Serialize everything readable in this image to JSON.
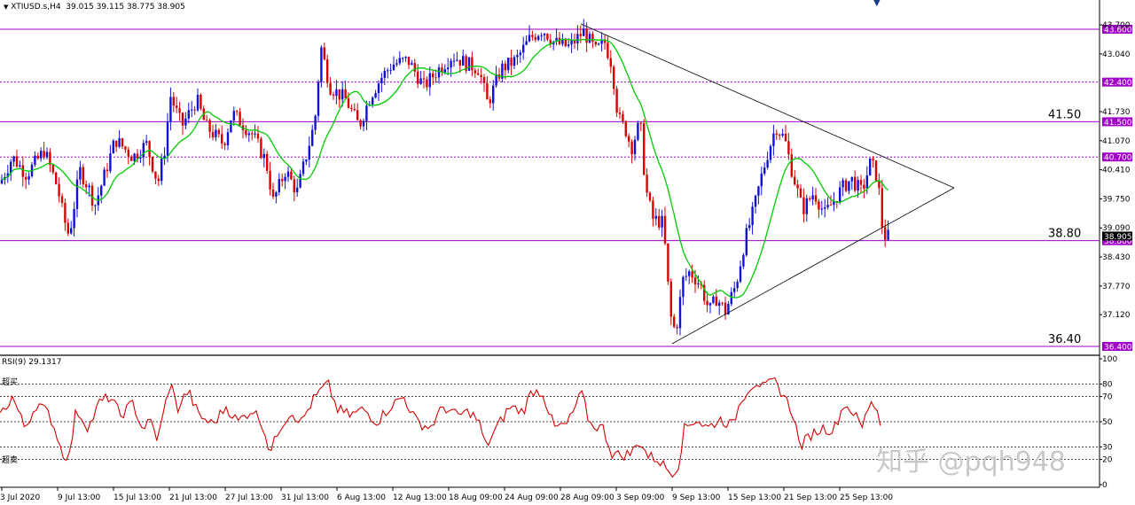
{
  "header": {
    "symbol": "XTIUSD.s,H4",
    "ohlc": "39.015 39.115 38.775 38.905",
    "rsi_label": "RSI(9) 29.1317",
    "overbought_label": "超买",
    "oversold_label": "超卖"
  },
  "watermark": "知乎 @pqh948",
  "chart_data": [
    {
      "type": "candlestick",
      "price_ticks": [
        "43.700",
        "43.040",
        "41.730",
        "41.070",
        "40.410",
        "39.750",
        "39.090",
        "38.430",
        "37.770",
        "37.120"
      ],
      "ylim": [
        36.4,
        43.7
      ],
      "current_price": "38.905",
      "levels": [
        {
          "value": 43.6,
          "label": "43.600"
        },
        {
          "value": 42.4,
          "label": "42.400",
          "style": "dotted"
        },
        {
          "value": 41.5,
          "label": "41.500",
          "text": "41.50"
        },
        {
          "value": 40.7,
          "label": "40.700",
          "style": "dotted"
        },
        {
          "value": 38.8,
          "label": "38.800",
          "text": "38.80"
        },
        {
          "value": 36.4,
          "label": "36.400",
          "text": "36.40"
        }
      ],
      "x_ticks": [
        "3 Jul 2020",
        "9 Jul 13:00",
        "15 Jul 13:00",
        "21 Jul 13:00",
        "27 Jul 13:00",
        "31 Jul 13:00",
        "6 Aug 13:00",
        "12 Aug 13:00",
        "18 Aug 09:00",
        "24 Aug 09:00",
        "28 Aug 09:00",
        "3 Sep 09:00",
        "9 Sep 13:00",
        "15 Sep 13:00",
        "21 Sep 13:00",
        "25 Sep 13:00"
      ],
      "close_path": [
        [
          0,
          40.1
        ],
        [
          14,
          40.7
        ],
        [
          30,
          40.3
        ],
        [
          50,
          40.85
        ],
        [
          65,
          40.0
        ],
        [
          72,
          39.3
        ],
        [
          78,
          38.9
        ],
        [
          90,
          40.4
        ],
        [
          100,
          40.0
        ],
        [
          107,
          39.6
        ],
        [
          118,
          40.3
        ],
        [
          130,
          41.1
        ],
        [
          150,
          40.7
        ],
        [
          165,
          41.0
        ],
        [
          178,
          40.1
        ],
        [
          186,
          40.9
        ],
        [
          192,
          42.1
        ],
        [
          205,
          41.4
        ],
        [
          222,
          42.0
        ],
        [
          232,
          41.4
        ],
        [
          252,
          41.0
        ],
        [
          262,
          41.7
        ],
        [
          285,
          41.2
        ],
        [
          300,
          40.6
        ],
        [
          308,
          39.7
        ],
        [
          322,
          40.4
        ],
        [
          335,
          39.9
        ],
        [
          345,
          40.7
        ],
        [
          355,
          41.5
        ],
        [
          362,
          43.2
        ],
        [
          372,
          42.3
        ],
        [
          390,
          42.0
        ],
        [
          405,
          41.4
        ],
        [
          418,
          42.1
        ],
        [
          430,
          42.5
        ],
        [
          442,
          42.8
        ],
        [
          460,
          42.9
        ],
        [
          478,
          42.3
        ],
        [
          495,
          42.7
        ],
        [
          510,
          43.0
        ],
        [
          528,
          42.8
        ],
        [
          540,
          42.7
        ],
        [
          550,
          41.9
        ],
        [
          565,
          42.7
        ],
        [
          582,
          42.9
        ],
        [
          598,
          43.4
        ],
        [
          612,
          43.6
        ],
        [
          625,
          43.3
        ],
        [
          642,
          43.2
        ],
        [
          658,
          43.55
        ],
        [
          672,
          43.1
        ],
        [
          682,
          43.3
        ],
        [
          690,
          42.8
        ],
        [
          697,
          41.6
        ],
        [
          706,
          41.3
        ],
        [
          712,
          40.9
        ],
        [
          722,
          41.5
        ],
        [
          728,
          40.0
        ],
        [
          736,
          39.3
        ],
        [
          748,
          39.2
        ],
        [
          756,
          37.1
        ],
        [
          762,
          36.7
        ],
        [
          770,
          37.9
        ],
        [
          778,
          38.1
        ],
        [
          790,
          37.8
        ],
        [
          800,
          37.2
        ],
        [
          808,
          37.5
        ],
        [
          818,
          37.2
        ],
        [
          830,
          37.8
        ],
        [
          840,
          38.8
        ],
        [
          850,
          39.5
        ],
        [
          858,
          40.2
        ],
        [
          866,
          40.8
        ],
        [
          875,
          41.4
        ],
        [
          885,
          41.1
        ],
        [
          893,
          40.4
        ],
        [
          905,
          39.5
        ],
        [
          918,
          39.9
        ],
        [
          930,
          39.4
        ],
        [
          940,
          39.7
        ],
        [
          950,
          40.0
        ],
        [
          960,
          40.2
        ],
        [
          972,
          39.9
        ],
        [
          982,
          40.6
        ],
        [
          990,
          40.2
        ],
        [
          996,
          38.9
        ],
        [
          1005,
          38.9
        ]
      ],
      "rsi": {
        "ticks": [
          "100",
          "80",
          "70",
          "50",
          "30",
          "20",
          "0"
        ],
        "ylim": [
          0,
          100
        ],
        "levels": [
          80,
          70,
          50,
          30,
          20
        ],
        "path": [
          [
            0,
            55
          ],
          [
            14,
            70
          ],
          [
            28,
            45
          ],
          [
            42,
            65
          ],
          [
            56,
            55
          ],
          [
            64,
            40
          ],
          [
            70,
            25
          ],
          [
            78,
            22
          ],
          [
            86,
            60
          ],
          [
            100,
            45
          ],
          [
            112,
            65
          ],
          [
            124,
            70
          ],
          [
            136,
            55
          ],
          [
            150,
            65
          ],
          [
            160,
            45
          ],
          [
            170,
            50
          ],
          [
            178,
            35
          ],
          [
            186,
            62
          ],
          [
            192,
            82
          ],
          [
            200,
            60
          ],
          [
            212,
            75
          ],
          [
            224,
            55
          ],
          [
            240,
            48
          ],
          [
            255,
            62
          ],
          [
            268,
            50
          ],
          [
            285,
            60
          ],
          [
            296,
            48
          ],
          [
            305,
            25
          ],
          [
            315,
            45
          ],
          [
            328,
            58
          ],
          [
            340,
            50
          ],
          [
            352,
            66
          ],
          [
            362,
            75
          ],
          [
            370,
            80
          ],
          [
            380,
            60
          ],
          [
            395,
            55
          ],
          [
            410,
            60
          ],
          [
            425,
            50
          ],
          [
            440,
            62
          ],
          [
            455,
            70
          ],
          [
            470,
            50
          ],
          [
            485,
            45
          ],
          [
            500,
            62
          ],
          [
            515,
            55
          ],
          [
            530,
            58
          ],
          [
            540,
            50
          ],
          [
            548,
            30
          ],
          [
            560,
            45
          ],
          [
            575,
            62
          ],
          [
            590,
            58
          ],
          [
            600,
            75
          ],
          [
            612,
            73
          ],
          [
            625,
            45
          ],
          [
            640,
            48
          ],
          [
            656,
            73
          ],
          [
            665,
            48
          ],
          [
            680,
            45
          ],
          [
            690,
            25
          ],
          [
            700,
            23
          ],
          [
            712,
            25
          ],
          [
            722,
            35
          ],
          [
            730,
            23
          ],
          [
            742,
            20
          ],
          [
            756,
            10
          ],
          [
            764,
            12
          ],
          [
            772,
            45
          ],
          [
            785,
            52
          ],
          [
            798,
            45
          ],
          [
            812,
            52
          ],
          [
            826,
            47
          ],
          [
            836,
            68
          ],
          [
            846,
            78
          ],
          [
            854,
            82
          ],
          [
            862,
            76
          ],
          [
            872,
            83
          ],
          [
            885,
            70
          ],
          [
            895,
            55
          ],
          [
            902,
            30
          ],
          [
            915,
            40
          ],
          [
            928,
            45
          ],
          [
            940,
            43
          ],
          [
            952,
            64
          ],
          [
            962,
            58
          ],
          [
            972,
            45
          ],
          [
            982,
            68
          ],
          [
            990,
            58
          ],
          [
            996,
            38
          ]
        ]
      },
      "colors": {
        "bull": "#1010d8",
        "bear": "#d80000",
        "ma": "#00cc00",
        "level": "#a000c8",
        "rsi": "#d80000"
      }
    }
  ]
}
